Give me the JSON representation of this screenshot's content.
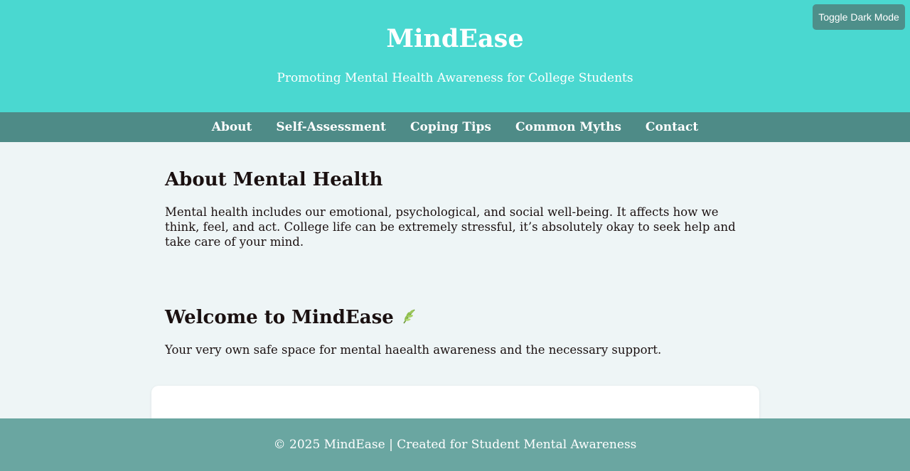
{
  "header": {
    "title": "MindEase",
    "tagline": "Promoting Mental Health Awareness for College Students",
    "toggle_label": "Toggle Dark Mode"
  },
  "nav": {
    "items": [
      "About",
      "Self-Assessment",
      "Coping Tips",
      "Common Myths",
      "Contact"
    ]
  },
  "about": {
    "heading": "About Mental Health",
    "text": "Mental health includes our emotional, psychological, and social well-being. It affects how we think, feel, and act. College life can be extremely stressful, it’s absolutely okay to seek help and take care of your mind."
  },
  "welcome": {
    "heading": "Welcome to MindEase",
    "icon": "herb-leaf-icon",
    "text": "Your very own safe space for mental haealth awareness and the necessary support."
  },
  "footer": {
    "text": "© 2025 MindEase | Created for Student Mental Awareness"
  },
  "colors": {
    "header_bg": "#4ad8d0",
    "nav_bg": "#4e8b87",
    "page_bg": "#eef5f6",
    "footer_bg": "#6aa6a1",
    "toggle_bg": "#4e8f8a"
  }
}
